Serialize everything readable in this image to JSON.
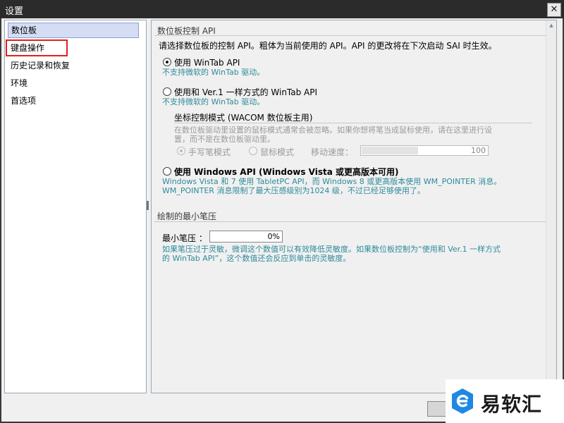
{
  "window": {
    "title": "设置",
    "close_label": "✕"
  },
  "sidebar": {
    "items": [
      {
        "label": "数位板",
        "selected": true
      },
      {
        "label": "键盘操作",
        "selected": false
      },
      {
        "label": "历史记录和恢复",
        "selected": false
      },
      {
        "label": "环境",
        "selected": false
      },
      {
        "label": "首选项",
        "selected": false
      }
    ]
  },
  "tablet": {
    "section_title": "数位板控制 API",
    "description": "请选择数位板的控制 API。粗体为当前使用的 API。API 的更改将在下次启动 SAI 时生效。",
    "option_wintab": {
      "label": "使用 WinTab API",
      "hint": "不支持微软的 WinTab 驱动。",
      "checked": true
    },
    "option_ver1": {
      "label": "使用和 Ver.1 一样方式的 WinTab API",
      "hint": "不支持微软的 WinTab 驱动。",
      "checked": false
    },
    "coord": {
      "title": "坐标控制模式 (WACOM 数位板主用)",
      "desc_line1": "在数位板驱动里设置的鼠标模式通常会被忽略。如果你想将笔当成鼠标使用，请在这里进行设",
      "desc_line2": "置，而不是在数位板驱动里。",
      "pen_mode_label": "手写笔模式",
      "mouse_mode_label": "鼠标模式",
      "speed_label": "移动速度：",
      "speed_value": "100",
      "speed_level": 0.45
    },
    "option_windows": {
      "label": "使用 Windows API (Windows Vista 或更高版本可用)",
      "hint_line1": "Windows Vista 和 7 使用 TabletPC API，而 Windows 8 或更高版本使用 WM_POINTER 消息。",
      "hint_line2": "WM_POINTER 消息限制了最大压感级别为1024 级，不过已经足够使用了。",
      "checked": false
    }
  },
  "pressure": {
    "section_title": "绘制的最小笔压",
    "label": "最小笔压 ：",
    "value": "0%",
    "hint_line1": "如果笔压过于灵敏，微调这个数值可以有效降低灵敏度。如果数位板控制为“使用和 Ver.1 一样方式",
    "hint_line2": "的 WinTab API”，这个数值还会反应到单击的灵敏度。"
  },
  "watermark": {
    "text": "易软汇",
    "logo_icon": "e-logo-icon"
  }
}
